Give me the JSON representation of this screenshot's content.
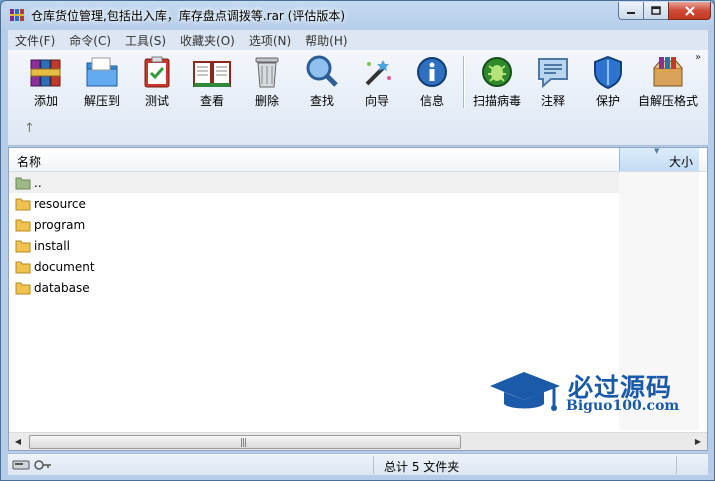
{
  "window": {
    "title": "仓库货位管理,包括出入库，库存盘点调拨等.rar (评估版本)"
  },
  "menu": [
    "文件(F)",
    "命令(C)",
    "工具(S)",
    "收藏夹(O)",
    "选项(N)",
    "帮助(H)"
  ],
  "toolbar": {
    "buttons": [
      {
        "label": "添加",
        "icon": "books-add-icon"
      },
      {
        "label": "解压到",
        "icon": "folder-extract-icon"
      },
      {
        "label": "测试",
        "icon": "clipboard-check-icon"
      },
      {
        "label": "查看",
        "icon": "open-book-icon"
      },
      {
        "label": "删除",
        "icon": "trash-can-icon"
      },
      {
        "label": "查找",
        "icon": "magnifier-icon"
      },
      {
        "label": "向导",
        "icon": "magic-wand-icon"
      },
      {
        "label": "信息",
        "icon": "info-icon"
      },
      {
        "label": "扫描病毒",
        "icon": "virus-scan-icon"
      },
      {
        "label": "注释",
        "icon": "comment-icon"
      },
      {
        "label": "保护",
        "icon": "shield-icon"
      },
      {
        "label": "自解压格式",
        "icon": "sfx-box-icon"
      }
    ],
    "more": "»",
    "up": "↑"
  },
  "list": {
    "columns": {
      "name": "名称",
      "size": "大小"
    },
    "rows": [
      {
        "name": "..",
        "type": "parent"
      },
      {
        "name": "resource",
        "type": "folder"
      },
      {
        "name": "program",
        "type": "folder"
      },
      {
        "name": "install",
        "type": "folder"
      },
      {
        "name": "document",
        "type": "folder"
      },
      {
        "name": "database",
        "type": "folder"
      }
    ]
  },
  "status": {
    "summary": "总计 5 文件夹"
  },
  "watermark": {
    "title": "必过源码",
    "url": "Biguo100.com"
  },
  "colors": {
    "accent": "#1a5aa8",
    "folder": "#e8b84a"
  }
}
